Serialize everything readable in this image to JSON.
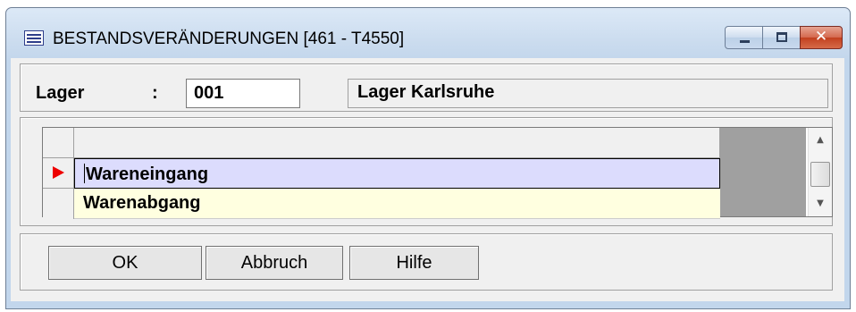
{
  "window": {
    "title": "BESTANDSVERÄNDERUNGEN  [461 - T4550]",
    "icon": "table-icon",
    "controls": {
      "minimize": "minimize-icon",
      "maximize": "maximize-icon",
      "close_glyph": "✕"
    }
  },
  "lager": {
    "label": "Lager",
    "colon": ":",
    "value": "001",
    "name": "Lager Karlsruhe"
  },
  "grid": {
    "header": "",
    "rows": [
      {
        "label": "Wareneingang",
        "selected": true
      },
      {
        "label": "Warenabgang",
        "selected": false
      }
    ],
    "selected_indicator_color": "#ee0000",
    "scroll_up": "▲",
    "scroll_down": "▼"
  },
  "buttons": {
    "ok": "OK",
    "cancel": "Abbruch",
    "help": "Hilfe"
  }
}
